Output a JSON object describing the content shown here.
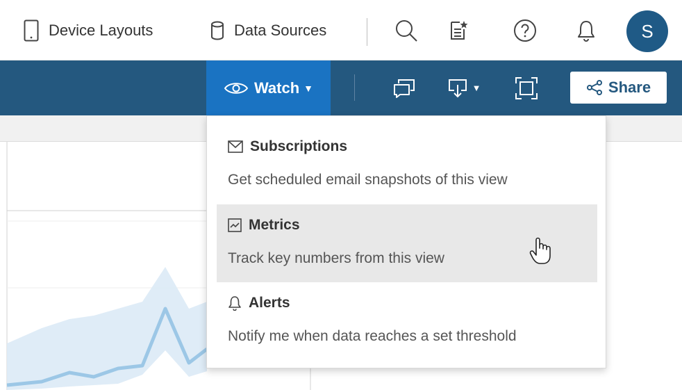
{
  "topbar": {
    "device_layouts_label": "Device Layouts",
    "data_sources_label": "Data Sources",
    "avatar_initial": "S"
  },
  "toolbar": {
    "watch_label": "Watch",
    "share_label": "Share"
  },
  "watch_menu": {
    "items": [
      {
        "title": "Subscriptions",
        "description": "Get scheduled email snapshots of this view",
        "icon": "envelope-icon"
      },
      {
        "title": "Metrics",
        "description": "Track key numbers from this view",
        "icon": "metrics-chart-icon",
        "hovered": true
      },
      {
        "title": "Alerts",
        "description": "Notify me when data reaches a set threshold",
        "icon": "bell-icon"
      }
    ]
  },
  "colors": {
    "toolbar_bg": "#24587f",
    "watch_button_bg": "#1a73c2",
    "avatar_bg": "#1f5a86",
    "menu_hover_bg": "#e8e8e8",
    "chart_line": "#9cc7e6",
    "chart_band": "#dbeaf6"
  }
}
